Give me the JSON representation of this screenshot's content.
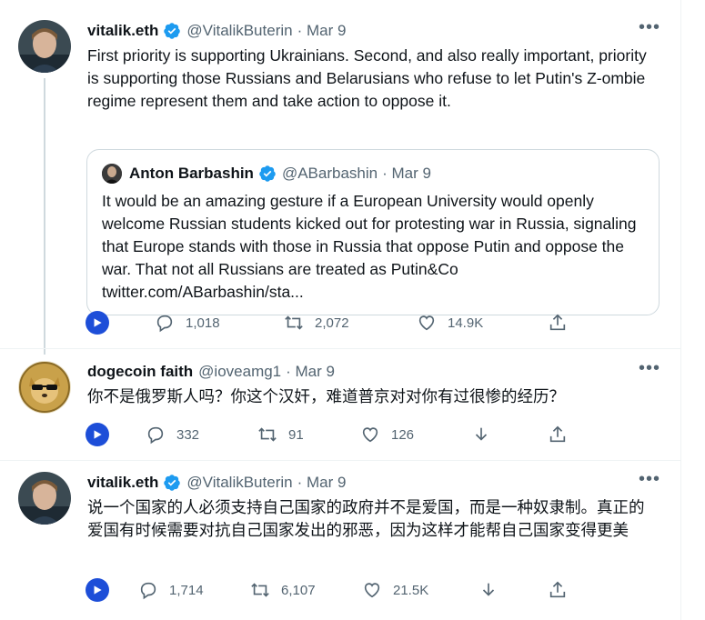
{
  "tweets": [
    {
      "name": "vitalik.eth",
      "handle": "@VitalikButerin",
      "date": "· Mar 9",
      "text": "First priority is supporting Ukrainians. Second, and also really important, priority is supporting those Russians and Belarusians who refuse to let Putin's Z-ombie regime represent them and take action to oppose it.",
      "quote": {
        "name": "Anton Barbashin",
        "handle": "@ABarbashin",
        "date": "· Mar 9",
        "text": "It would be an amazing gesture if a European University would openly welcome Russian students kicked out for protesting war in Russia, signaling that Europe stands with those in Russia that oppose Putin and oppose the war. That not all Russians are treated as Putin&Co",
        "link": "twitter.com/ABarbashin/sta..."
      },
      "replies": "1,018",
      "retweets": "2,072",
      "likes": "14.9K"
    },
    {
      "name": "dogecoin faith",
      "handle": "@ioveamg1",
      "date": "· Mar 9",
      "text": "你不是俄罗斯人吗？你这个汉奸，难道普京对对你有过很惨的经历？",
      "replies": "332",
      "retweets": "91",
      "likes": "126"
    },
    {
      "name": "vitalik.eth",
      "handle": "@VitalikButerin",
      "date": "· Mar 9",
      "text": "说一个国家的人必须支持自己国家的政府并不是爱国，而是一种奴隶制。真正的爱国有时候需要对抗自己国家发出的邪恶，因为这样才能帮自己国家变得更美",
      "replies": "1,714",
      "retweets": "6,107",
      "likes": "21.5K"
    }
  ],
  "ui": {
    "more": "•••"
  },
  "colors": {
    "verified": "#1d9bf0",
    "muted": "#536471",
    "play": "#1d4ed8",
    "border": "#cfd9de"
  },
  "icons": [
    "verified-badge-icon",
    "more-icon",
    "play-icon",
    "reply-icon",
    "retweet-icon",
    "like-icon",
    "download-icon",
    "share-icon"
  ]
}
